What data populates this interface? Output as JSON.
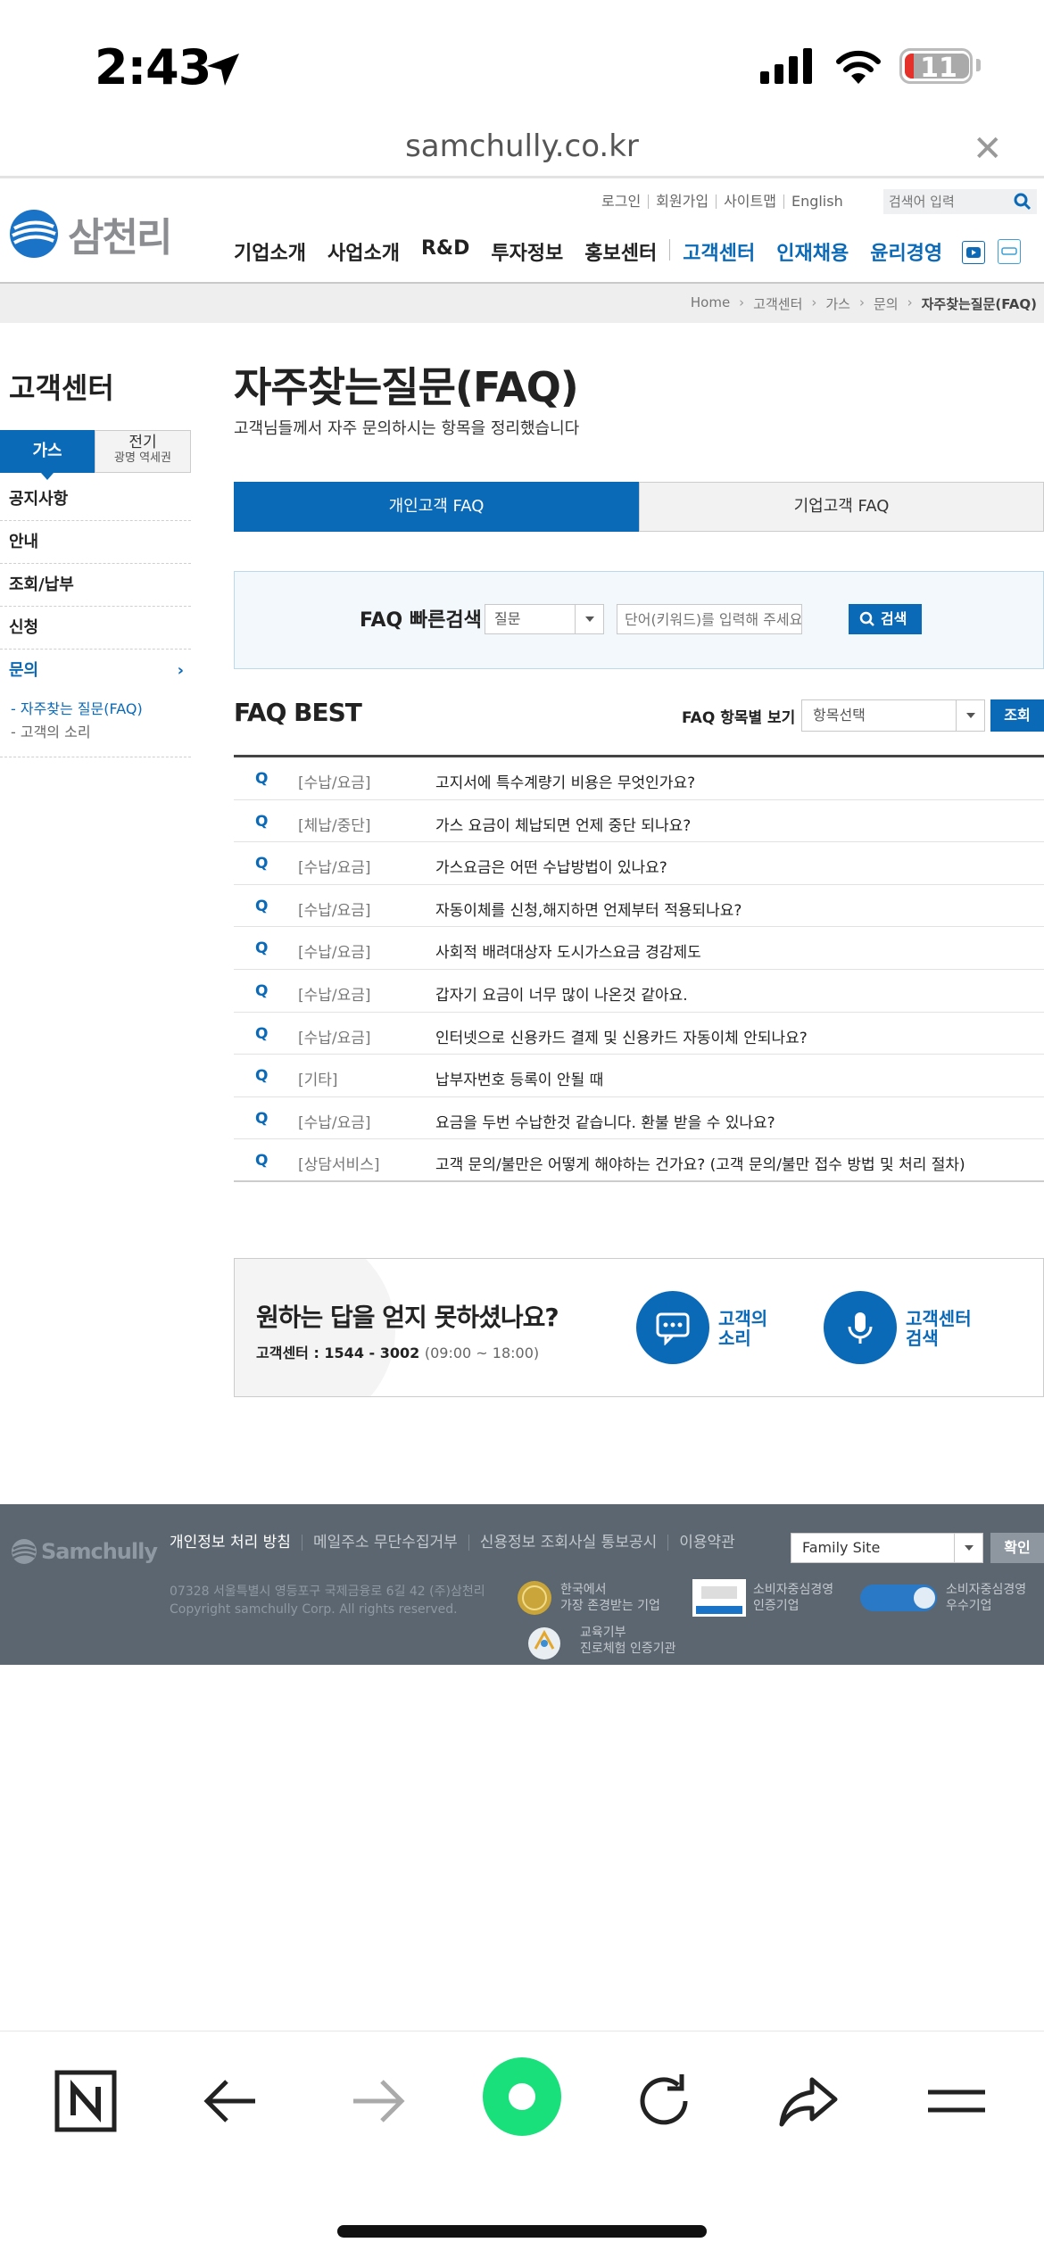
{
  "status_bar": {
    "time": "2:43",
    "battery": "11"
  },
  "browser": {
    "url": "samchully.co.kr"
  },
  "header": {
    "logo_text": "삼천리",
    "util_links": [
      "로그인",
      "회원가입",
      "사이트맵",
      "English"
    ],
    "search_placeholder": "검색어 입력",
    "nav": [
      "기업소개",
      "사업소개",
      "R&D",
      "투자정보",
      "홍보센터"
    ],
    "nav_blue": [
      "고객센터",
      "인재채용",
      "윤리경영"
    ]
  },
  "breadcrumb": [
    "Home",
    "고객센터",
    "가스",
    "문의",
    "자주찾는질문(FAQ)"
  ],
  "sidebar": {
    "title": "고객센터",
    "tab_gas": "가스",
    "tab_elec": "전기",
    "tab_elec_sub": "광명 역세권",
    "items": [
      "공지사항",
      "안내",
      "조회/납부",
      "신청",
      "문의"
    ],
    "sub_items": [
      "자주찾는 질문(FAQ)",
      "고객의 소리"
    ]
  },
  "main": {
    "title": "자주찾는질문(FAQ)",
    "desc": "고객님들께서 자주 문의하시는 항목을 정리했습니다",
    "tab_personal": "개인고객 FAQ",
    "tab_business": "기업고객 FAQ",
    "quick_label": "FAQ 빠른검색",
    "quick_select": "질문",
    "quick_placeholder": "단어(키워드)를 입력해 주세요",
    "quick_button": "검색",
    "best_title": "FAQ BEST",
    "filter_label": "FAQ 항목별 보기",
    "filter_select": "항목선택",
    "filter_button": "조회"
  },
  "faq": [
    {
      "q": "Q",
      "cat": "[수납/요금]",
      "text": "고지서에 특수계량기 비용은 무엇인가요?"
    },
    {
      "q": "Q",
      "cat": "[체납/중단]",
      "text": "가스 요금이 체납되면 언제 중단 되나요?"
    },
    {
      "q": "Q",
      "cat": "[수납/요금]",
      "text": "가스요금은 어떤 수납방법이 있나요?"
    },
    {
      "q": "Q",
      "cat": "[수납/요금]",
      "text": "자동이체를 신청,해지하면 언제부터 적용되나요?"
    },
    {
      "q": "Q",
      "cat": "[수납/요금]",
      "text": "사회적 배려대상자 도시가스요금 경감제도"
    },
    {
      "q": "Q",
      "cat": "[수납/요금]",
      "text": "갑자기 요금이 너무 많이 나온것 같아요."
    },
    {
      "q": "Q",
      "cat": "[수납/요금]",
      "text": "인터넷으로 신용카드 결제 및 신용카드 자동이체 안되나요?"
    },
    {
      "q": "Q",
      "cat": "[기타]",
      "text": "납부자번호 등록이 안될 때"
    },
    {
      "q": "Q",
      "cat": "[수납/요금]",
      "text": "요금을 두번 수납한것 같습니다. 환불 받을 수 있나요?"
    },
    {
      "q": "Q",
      "cat": "[상담서비스]",
      "text": "고객 문의/불만은 어떻게 해야하는 건가요? (고객 문의/불만 접수 방법 및 처리 절차)"
    }
  ],
  "help": {
    "title": "원하는 답을 얻지 못하셨나요?",
    "tel": "고객센터 : 1544 - 3002",
    "hours": "(09:00 ~ 18:00)",
    "voice_l1": "고객의",
    "voice_l2": "소리",
    "search_l1": "고객센터",
    "search_l2": "검색"
  },
  "footer": {
    "logo": "Samchully",
    "links": [
      "개인정보 처리 방침",
      "메일주소 무단수집거부",
      "신용정보 조회사실 통보공시",
      "이용약관"
    ],
    "address": "07328 서울특별시 영등포구 국제금융로 6길 42 (주)삼천리",
    "copyright": "Copyright samchully Corp. All rights reserved.",
    "family_site": "Family Site",
    "family_button": "확인",
    "cert1_l1": "한국에서",
    "cert1_l2": "가장 존경받는 기업",
    "cert2_l1": "소비자중심경영",
    "cert2_l2": "인증기업",
    "cert3_l1": "소비자중심경영",
    "cert3_l2": "우수기업",
    "cert4_l1": "교육기부",
    "cert4_l2": "진로체험 인증기관"
  },
  "colors": {
    "brand_blue": "#0b6ab8",
    "footer_bg": "#5c6670",
    "app_green": "#19e07a"
  }
}
